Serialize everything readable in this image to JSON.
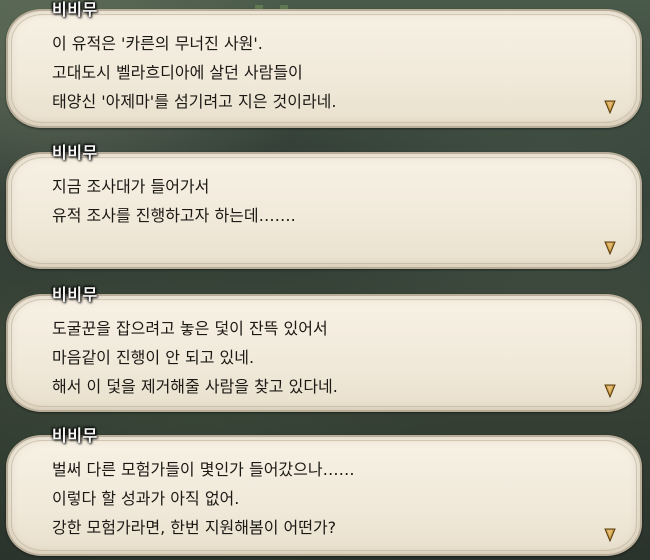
{
  "dialogs": [
    {
      "speaker": "비비무",
      "lines": [
        "이 유적은 '카른의 무너진 사원'.",
        "고대도시 벨라흐디아에 살던 사람들이",
        "태양신 '아제마'를 섬기려고 지은 것이라네."
      ]
    },
    {
      "speaker": "비비무",
      "lines": [
        "지금 조사대가 들어가서",
        "유적 조사를 진행하고자 하는데……."
      ]
    },
    {
      "speaker": "비비무",
      "lines": [
        "도굴꾼을 잡으려고 놓은 덫이 잔뜩 있어서",
        "마음같이 진행이 안 되고 있네.",
        "해서 이 덫을 제거해줄 사람을 찾고 있다네."
      ]
    },
    {
      "speaker": "비비무",
      "lines": [
        "벌써 다른 모험가들이 몇인가 들어갔으나……",
        "이렇다 할 성과가 아직 없어.",
        "강한 모험가라면, 한번 지원해봄이 어떤가?"
      ]
    }
  ],
  "continue_icon": "diamond-arrow-icon",
  "colors": {
    "bubble": "#f1eadb",
    "text": "#1c1915",
    "speaker": "#f7f7f7",
    "icon": "#c59a45"
  }
}
